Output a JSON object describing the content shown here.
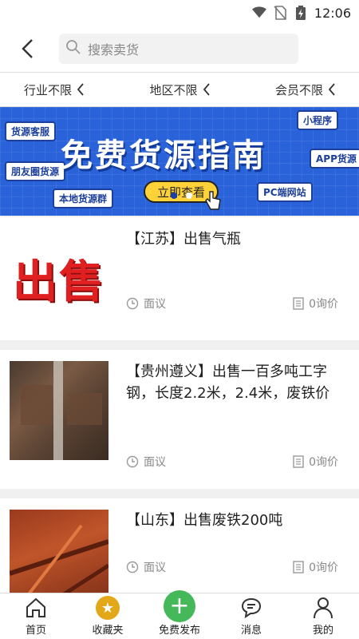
{
  "status": {
    "time": "12:06"
  },
  "search": {
    "placeholder": "搜索卖货"
  },
  "filters": [
    {
      "label": "行业不限"
    },
    {
      "label": "地区不限"
    },
    {
      "label": "会员不限"
    }
  ],
  "banner": {
    "title": "免费货源指南",
    "cta": "立即查看",
    "tags": [
      "货源客服",
      "朋友圈货源",
      "本地货源群",
      "小程序",
      "APP货源",
      "PC端网站"
    ]
  },
  "listings": [
    {
      "title": "【江苏】出售气瓶",
      "thumb_text": "出售",
      "price": "面议",
      "inquiries": "0询价"
    },
    {
      "title": "【贵州遵义】出售一百多吨工字钢，长度2.2米，2.4米，废铁价",
      "price": "面议",
      "inquiries": "0询价"
    },
    {
      "title": "【山东】出售废铁200吨",
      "price": "面议",
      "inquiries": "0询价"
    }
  ],
  "tabbar": [
    {
      "label": "首页"
    },
    {
      "label": "收藏夹"
    },
    {
      "label": "免费发布"
    },
    {
      "label": "消息"
    },
    {
      "label": "我的"
    }
  ],
  "colors": {
    "banner_bg": "#2a63d9",
    "cta_bg": "#ffd23a",
    "fav": "#e3a81a",
    "publish": "#45b95a",
    "thumb_red": "#e02020"
  }
}
